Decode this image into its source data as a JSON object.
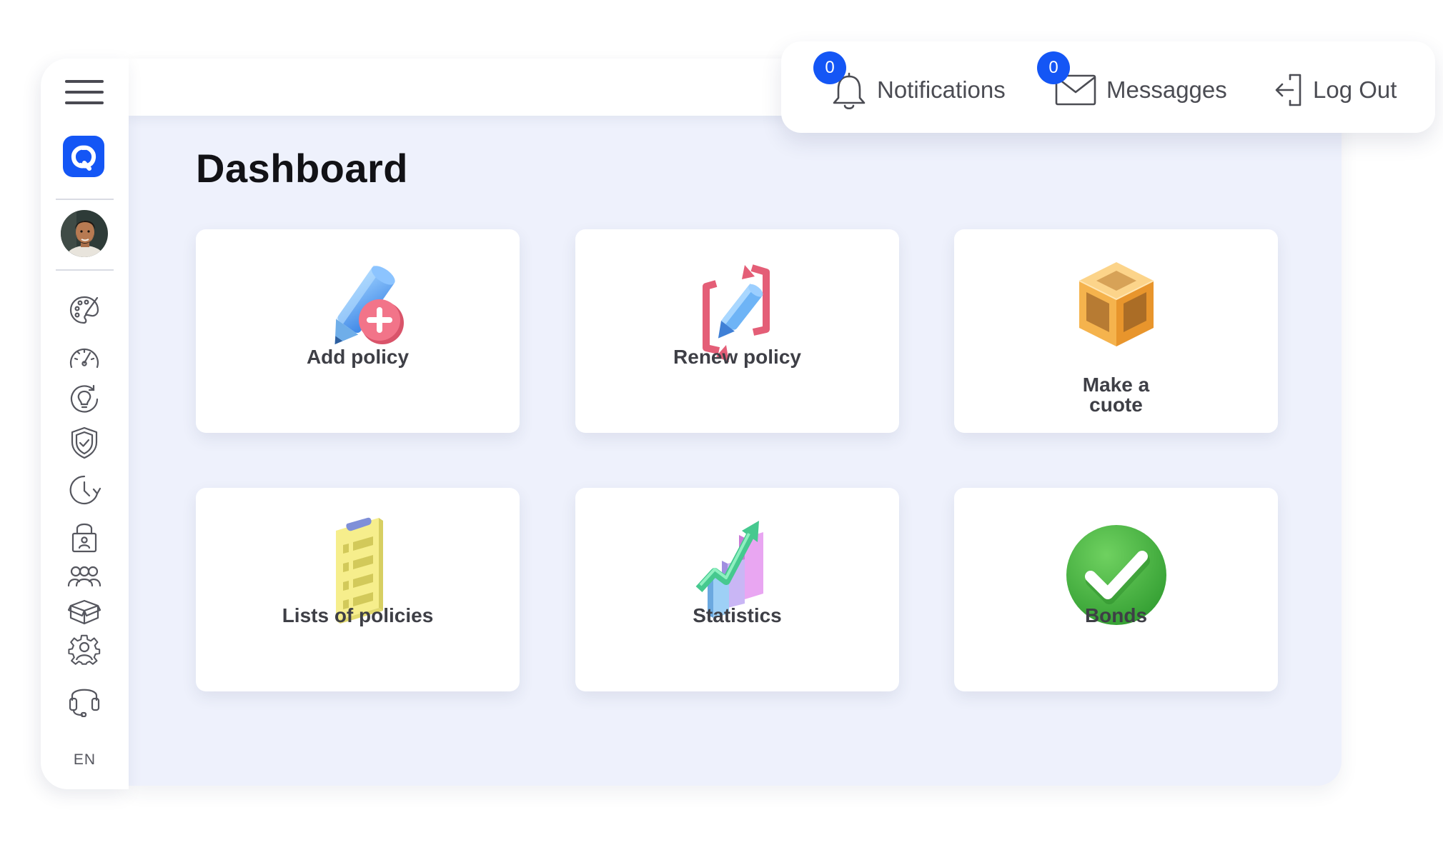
{
  "header": {
    "notifications": {
      "label": "Notifications",
      "count": "0"
    },
    "messages": {
      "label": "Messagges",
      "count": "0"
    },
    "logout": {
      "label": "Log Out"
    }
  },
  "sidebar": {
    "language": "EN",
    "items": [
      {
        "icon": "palette-icon"
      },
      {
        "icon": "speedometer-icon"
      },
      {
        "icon": "lightbulb-icon"
      },
      {
        "icon": "shield-check-icon"
      },
      {
        "icon": "history-icon"
      },
      {
        "icon": "lock-user-icon"
      },
      {
        "icon": "team-icon"
      },
      {
        "icon": "box-icon"
      },
      {
        "icon": "settings-user-icon"
      },
      {
        "icon": "headset-icon"
      }
    ]
  },
  "main": {
    "title": "Dashboard",
    "cards": [
      {
        "label": "Add policy",
        "icon": "pencil-plus-icon"
      },
      {
        "label": "Renew policy",
        "icon": "renew-pencil-icon"
      },
      {
        "label_line1": "Make a",
        "label_line2": "cuote",
        "icon": "box-3d-icon"
      },
      {
        "label": "Lists of policies",
        "icon": "clipboard-list-icon"
      },
      {
        "label": "Statistics",
        "icon": "bar-chart-icon"
      },
      {
        "label": "Bonds",
        "icon": "checkmark-icon"
      }
    ]
  },
  "colors": {
    "accent": "#1456f5",
    "workspace_bg": "#eef1fc",
    "success": "#3daa3a"
  }
}
